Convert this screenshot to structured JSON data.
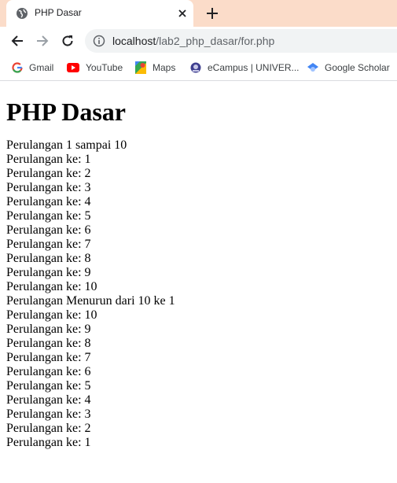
{
  "tab": {
    "title": "PHP Dasar"
  },
  "omnibox": {
    "host": "localhost",
    "path": "/lab2_php_dasar/for.php"
  },
  "bookmarks": [
    {
      "label": "Gmail",
      "icon": "google-icon"
    },
    {
      "label": "YouTube",
      "icon": "youtube-icon"
    },
    {
      "label": "Maps",
      "icon": "maps-icon"
    },
    {
      "label": "eCampus | UNIVER...",
      "icon": "ecampus-icon"
    },
    {
      "label": "Google Scholar",
      "icon": "scholar-icon"
    }
  ],
  "page": {
    "heading": "PHP Dasar",
    "lines": [
      "Perulangan 1 sampai 10",
      "Perulangan ke: 1",
      "Perulangan ke: 2",
      "Perulangan ke: 3",
      "Perulangan ke: 4",
      "Perulangan ke: 5",
      "Perulangan ke: 6",
      "Perulangan ke: 7",
      "Perulangan ke: 8",
      "Perulangan ke: 9",
      "Perulangan ke: 10",
      "Perulangan Menurun dari 10 ke 1",
      "Perulangan ke: 10",
      "Perulangan ke: 9",
      "Perulangan ke: 8",
      "Perulangan ke: 7",
      "Perulangan ke: 6",
      "Perulangan ke: 5",
      "Perulangan ke: 4",
      "Perulangan ke: 3",
      "Perulangan ke: 2",
      "Perulangan ke: 1"
    ]
  },
  "colors": {
    "tabbar": "#fbdcc9",
    "omnibox": "#f1f3f4",
    "text": "#000000"
  }
}
